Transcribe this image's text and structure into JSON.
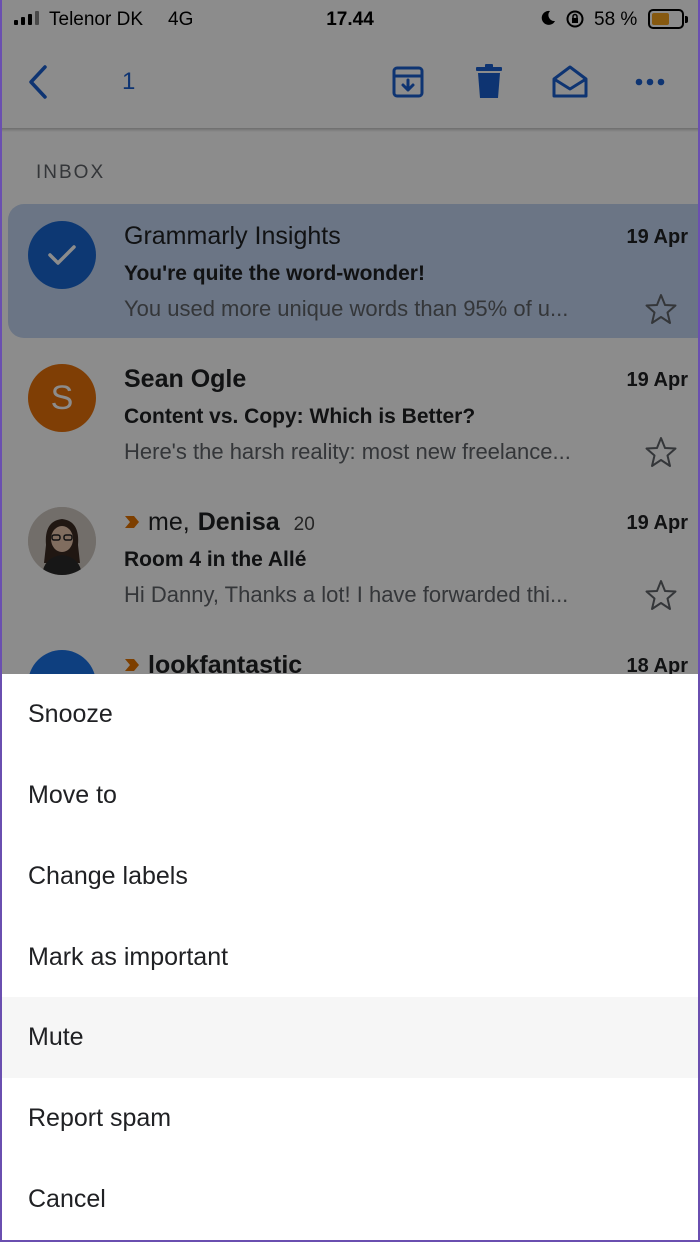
{
  "status_bar": {
    "carrier": "Telenor DK",
    "network": "4G",
    "time": "17.44",
    "battery_percent": "58 %",
    "battery_level": 0.58,
    "battery_color": "#f4a31e"
  },
  "toolbar": {
    "selected_count": "1",
    "icons": [
      "back-icon",
      "archive-icon",
      "trash-icon",
      "mark-read-icon",
      "more-icon"
    ],
    "accent_color": "#1a5fd0"
  },
  "section_label": "INBOX",
  "emails": [
    {
      "sender": "Grammarly Insights",
      "date": "19 Apr",
      "subject": "You're quite the word-wonder!",
      "snippet": "You used more unique words than 95% of u...",
      "selected": true,
      "avatar": "check-icon"
    },
    {
      "sender": "Sean Ogle",
      "date": "19 Apr",
      "subject": "Content vs. Copy: Which is Better?",
      "snippet": "Here's the harsh reality: most new freelance...",
      "avatar_letter": "S",
      "avatar_color": "#e8710a"
    },
    {
      "sender_prefix": "me,",
      "sender": "Denisa",
      "thread_count": "20",
      "date": "19 Apr",
      "subject": "Room 4 in the Allé",
      "snippet": "Hi Danny, Thanks a lot! I have forwarded thi...",
      "important": true
    },
    {
      "sender": "lookfantastic",
      "date": "18 Apr",
      "important": true
    }
  ],
  "sheet": {
    "items": [
      "Snooze",
      "Move to",
      "Change labels",
      "Mark as important",
      "Mute",
      "Report spam",
      "Cancel"
    ],
    "highlighted": "Mute"
  }
}
